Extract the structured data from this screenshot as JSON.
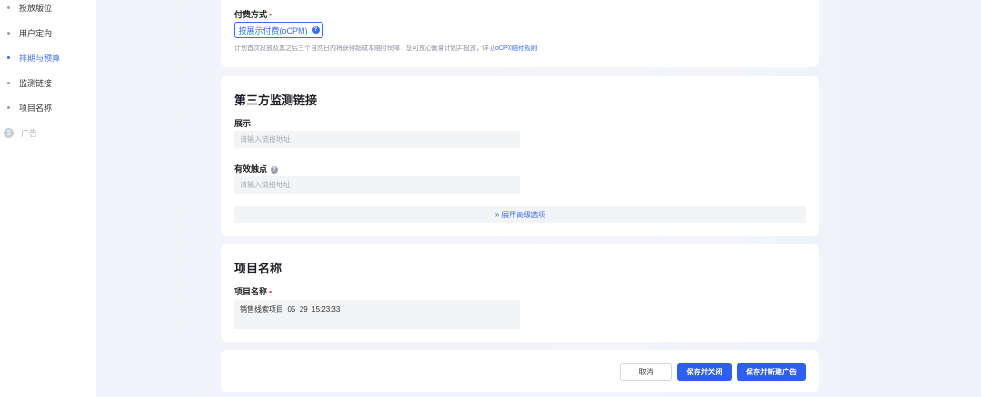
{
  "sidebar": {
    "items": [
      {
        "label": "投放版位",
        "active": false
      },
      {
        "label": "用户定向",
        "active": false
      },
      {
        "label": "排期与预算",
        "active": true
      },
      {
        "label": "监测链接",
        "active": false
      },
      {
        "label": "项目名称",
        "active": false
      }
    ],
    "step": {
      "number": "2",
      "label": "广告"
    }
  },
  "payment": {
    "label": "付费方式",
    "button_label": "按展示付费(oCPM)",
    "hint_text": "计划首次投放及其之后三个自然日内将获得超成本赔付保障，您可放心衡量计划并投放，详见",
    "hint_link": "oCPX赔付规则"
  },
  "monitor": {
    "title": "第三方监测链接",
    "impression_label": "展示",
    "impression_placeholder": "请输入链接地址",
    "click_label": "有效触点",
    "click_placeholder": "请输入链接地址",
    "advanced_label": "展开高级选项"
  },
  "project": {
    "title": "项目名称",
    "name_label": "项目名称",
    "name_value": "销售线索项目_05_29_15:23:33"
  },
  "footer": {
    "cancel_label": "取消",
    "save_close_label": "保存并关闭",
    "save_new_label": "保存并新建广告"
  },
  "colors": {
    "accent": "#3b6cf2",
    "required": "#e5484d"
  }
}
